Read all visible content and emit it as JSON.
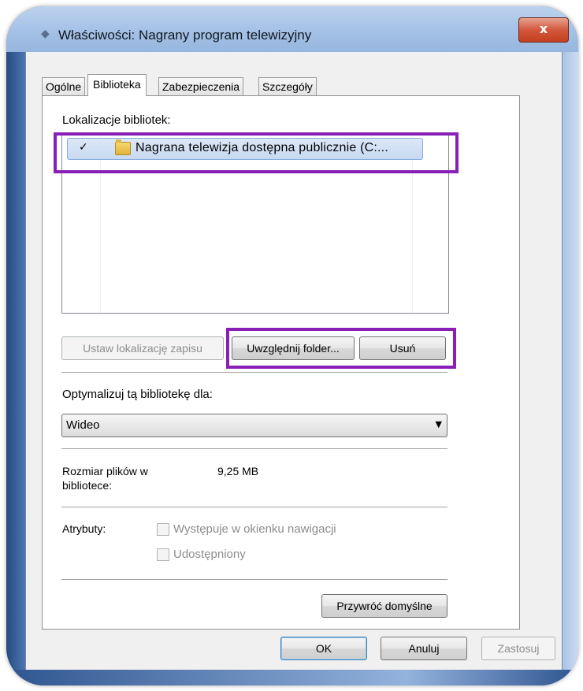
{
  "window": {
    "title": "Właściwości: Nagrany program telewizyjny",
    "close_glyph": "x"
  },
  "tabs": [
    {
      "label": "Ogólne",
      "active": false
    },
    {
      "label": "Biblioteka",
      "active": true
    },
    {
      "label": "Zabezpieczenia",
      "active": false
    },
    {
      "label": "Szczegóły",
      "active": false
    }
  ],
  "library": {
    "locations_label": "Lokalizacje bibliotek:",
    "items": [
      {
        "check": "✓",
        "icon": "folder-icon",
        "name": "Nagrana telewizja dostępna publicznie (C:..."
      }
    ],
    "set_save_location_label": "Ustaw lokalizację zapisu",
    "include_folder_label": "Uwzględnij folder...",
    "remove_label": "Usuń"
  },
  "optimize": {
    "label": "Optymalizuj tą bibliotekę dla:",
    "selected": "Wideo"
  },
  "size": {
    "label_line1": "Rozmiar plików w",
    "label_line2": "bibliotece:",
    "value": "9,25 MB"
  },
  "attributes": {
    "label": "Atrybuty:",
    "show_in_nav": {
      "label": "Występuje w okienku nawigacji",
      "checked": false,
      "enabled": false
    },
    "shared": {
      "label": "Udostępniony",
      "checked": false,
      "enabled": false
    }
  },
  "restore_defaults_label": "Przywróć domyślne",
  "footer": {
    "ok_label": "OK",
    "cancel_label": "Anuluj",
    "apply_label": "Zastosuj"
  },
  "colors": {
    "highlight": "#8a1fb8",
    "titlebar": "#a6c2e6"
  }
}
